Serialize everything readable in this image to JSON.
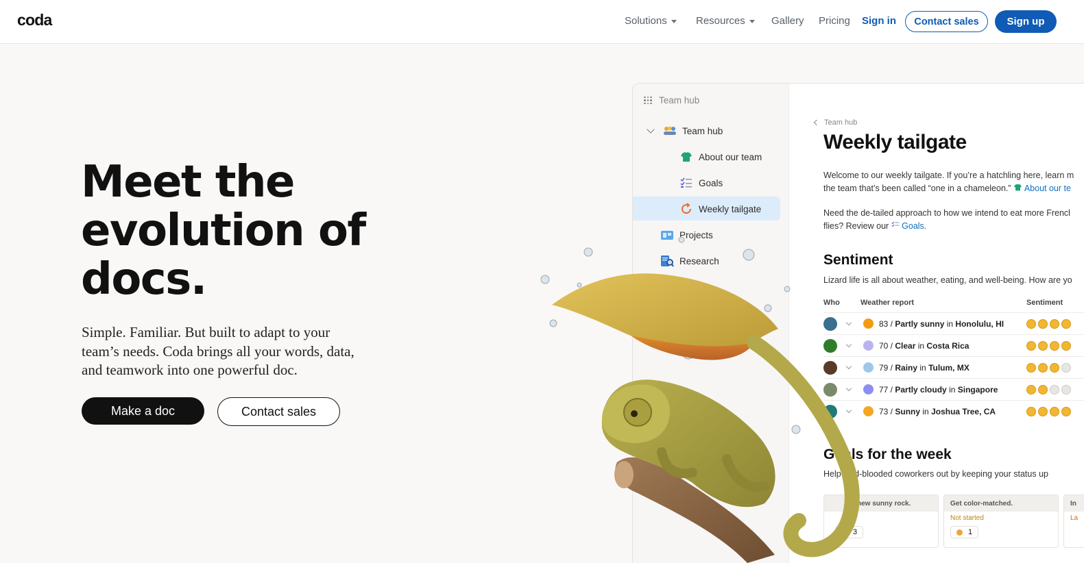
{
  "nav": {
    "logo": "coda",
    "solutions": "Solutions",
    "resources": "Resources",
    "gallery": "Gallery",
    "pricing": "Pricing",
    "sign_in": "Sign in",
    "contact_sales": "Contact sales",
    "sign_up": "Sign up"
  },
  "hero": {
    "title_line1": "Meet the",
    "title_line2": "evolution of",
    "title_line3": "docs.",
    "subtitle": "Simple. Familiar. But built to adapt to your team’s needs. Coda brings all your words, data, and teamwork into one powerful doc.",
    "make_doc": "Make a doc",
    "contact_sales": "Contact sales"
  },
  "doc": {
    "sidebar": {
      "header": "Team hub",
      "items": [
        {
          "label": "Team hub",
          "icon": "people-icon"
        },
        {
          "label": "About our team",
          "icon": "shirt-icon"
        },
        {
          "label": "Goals",
          "icon": "checklist-icon"
        },
        {
          "label": "Weekly tailgate",
          "icon": "refresh-icon"
        },
        {
          "label": "Projects",
          "icon": "board-icon"
        },
        {
          "label": "Research",
          "icon": "research-icon"
        }
      ]
    },
    "breadcrumb": "Team hub",
    "title": "Weekly tailgate",
    "intro_line1": "Welcome to our weekly tailgate. If you’re a hatchling here, learn m",
    "intro_line2_text": "the team that’s been called “one in a chameleon.”",
    "intro_line2_link": "About our te",
    "para2_line1": "Need the de-tailed approach to how we intend to eat more Frencl",
    "para2_line2_text": "flies? Review our",
    "para2_line2_link": "Goals.",
    "sentiment_heading": "Sentiment",
    "sentiment_desc": "Lizard life is all about weather, eating, and well-being. How are yo",
    "columns": [
      "Who",
      "Weather report",
      "Sentiment"
    ],
    "rows": [
      {
        "temp": "83 /",
        "cond": "Partly sunny",
        "in": "in",
        "place": "Honolulu, HI",
        "wx_color": "#f39c12",
        "avatar_color": "#3b6e8f",
        "faces": 4
      },
      {
        "temp": "70 /",
        "cond": "Clear",
        "in": "in",
        "place": "Costa Rica",
        "wx_color": "#b9b4f0",
        "avatar_color": "#2f7d2a",
        "faces": 4
      },
      {
        "temp": "79 /",
        "cond": "Rainy",
        "in": "in",
        "place": "Tulum, MX",
        "wx_color": "#9fc7ea",
        "avatar_color": "#5a3b2a",
        "faces": 3
      },
      {
        "temp": "77 /",
        "cond": "Partly cloudy",
        "in": "in",
        "place": "Singapore",
        "wx_color": "#8d8ef0",
        "avatar_color": "#7a8a6a",
        "faces": 2
      },
      {
        "temp": "73 /",
        "cond": "Sunny",
        "in": "in",
        "place": "Joshua Tree, CA",
        "wx_color": "#f5a623",
        "avatar_color": "#1f7a7a",
        "faces": 4
      }
    ],
    "goals_heading": "Goals for the week",
    "goals_desc": "Help cold-blooded coworkers out by keeping your status up",
    "cards": [
      {
        "title": "new sunny rock.",
        "status": "ack",
        "count": "3"
      },
      {
        "title": "Get color-matched.",
        "status": "Not started",
        "count": "1"
      },
      {
        "title": "In",
        "status": "La",
        "count": ""
      }
    ]
  }
}
